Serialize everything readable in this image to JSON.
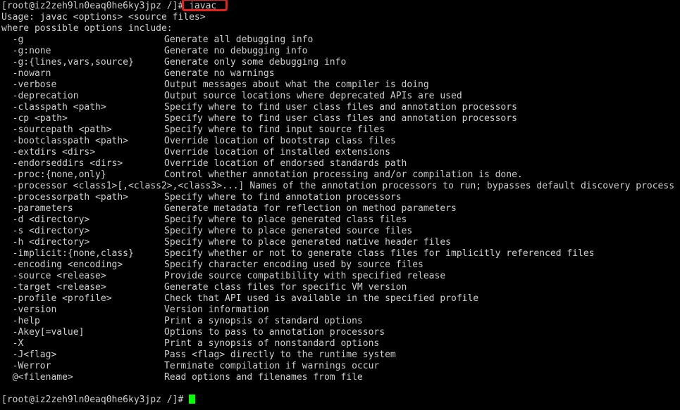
{
  "terminal": {
    "background_color": "#000000",
    "text_color": "#cfcfcf",
    "cursor_color": "#00ff00",
    "highlight_color": "#e8201c"
  },
  "session": {
    "prompt": "[root@iz2zeh9ln0eaq0he6ky3jpz /]#",
    "command": "javac",
    "usage_line": "Usage: javac <options> <source files>",
    "where_line": "where possible options include:",
    "final_prompt": "[root@iz2zeh9ln0eaq0he6ky3jpz /]#"
  },
  "options": [
    {
      "name": "-g",
      "desc": "Generate all debugging info"
    },
    {
      "name": "-g:none",
      "desc": "Generate no debugging info"
    },
    {
      "name": "-g:{lines,vars,source}",
      "desc": "Generate only some debugging info"
    },
    {
      "name": "-nowarn",
      "desc": "Generate no warnings"
    },
    {
      "name": "-verbose",
      "desc": "Output messages about what the compiler is doing"
    },
    {
      "name": "-deprecation",
      "desc": "Output source locations where deprecated APIs are used"
    },
    {
      "name": "-classpath <path>",
      "desc": "Specify where to find user class files and annotation processors"
    },
    {
      "name": "-cp <path>",
      "desc": "Specify where to find user class files and annotation processors"
    },
    {
      "name": "-sourcepath <path>",
      "desc": "Specify where to find input source files"
    },
    {
      "name": "-bootclasspath <path>",
      "desc": "Override location of bootstrap class files"
    },
    {
      "name": "-extdirs <dirs>",
      "desc": "Override location of installed extensions"
    },
    {
      "name": "-endorseddirs <dirs>",
      "desc": "Override location of endorsed standards path"
    },
    {
      "name": "-proc:{none,only}",
      "desc": "Control whether annotation processing and/or compilation is done."
    },
    {
      "name": "-processor <class1>[,<class2>,<class3>...]",
      "desc": "Names of the annotation processors to run; bypasses default discovery process",
      "overflow": true
    },
    {
      "name": "-processorpath <path>",
      "desc": "Specify where to find annotation processors"
    },
    {
      "name": "-parameters",
      "desc": "Generate metadata for reflection on method parameters"
    },
    {
      "name": "-d <directory>",
      "desc": "Specify where to place generated class files"
    },
    {
      "name": "-s <directory>",
      "desc": "Specify where to place generated source files"
    },
    {
      "name": "-h <directory>",
      "desc": "Specify where to place generated native header files"
    },
    {
      "name": "-implicit:{none,class}",
      "desc": "Specify whether or not to generate class files for implicitly referenced files"
    },
    {
      "name": "-encoding <encoding>",
      "desc": "Specify character encoding used by source files"
    },
    {
      "name": "-source <release>",
      "desc": "Provide source compatibility with specified release"
    },
    {
      "name": "-target <release>",
      "desc": "Generate class files for specific VM version"
    },
    {
      "name": "-profile <profile>",
      "desc": "Check that API used is available in the specified profile"
    },
    {
      "name": "-version",
      "desc": "Version information"
    },
    {
      "name": "-help",
      "desc": "Print a synopsis of standard options"
    },
    {
      "name": "-Akey[=value]",
      "desc": "Options to pass to annotation processors"
    },
    {
      "name": "-X",
      "desc": "Print a synopsis of nonstandard options"
    },
    {
      "name": "-J<flag>",
      "desc": "Pass <flag> directly to the runtime system"
    },
    {
      "name": "-Werror",
      "desc": "Terminate compilation if warnings occur"
    },
    {
      "name": "@<filename>",
      "desc": "Read options and filenames from file"
    }
  ]
}
